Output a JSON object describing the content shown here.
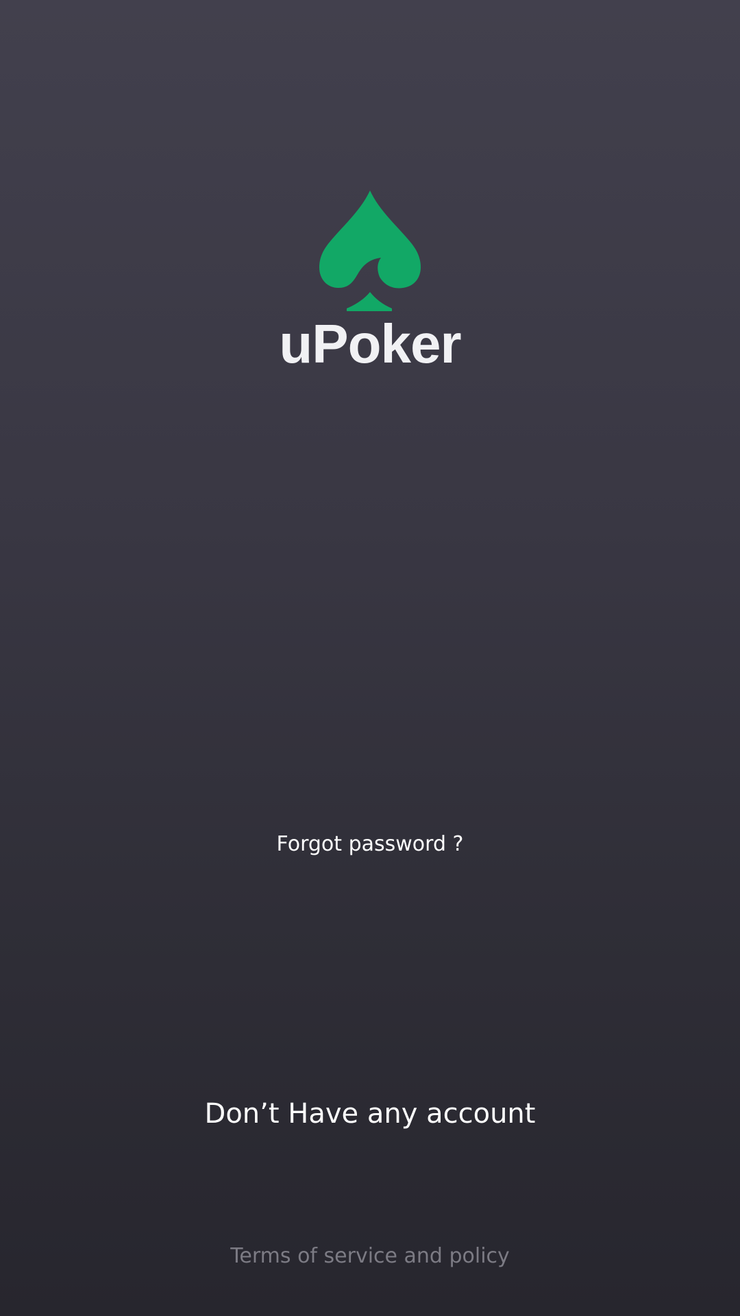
{
  "brand": {
    "app_name": "uPoker",
    "logo_icon": "spade-icon",
    "accent_color": "#12a866"
  },
  "login": {
    "forgot_password_label": "Forgot password ?",
    "no_account_label": "Don’t Have any account"
  },
  "footer": {
    "terms_label": "Terms of service and policy"
  },
  "colors": {
    "background_top": "#42404d",
    "background_bottom": "#27262e",
    "text_primary": "#ffffff",
    "text_muted": "#7c7b84"
  }
}
